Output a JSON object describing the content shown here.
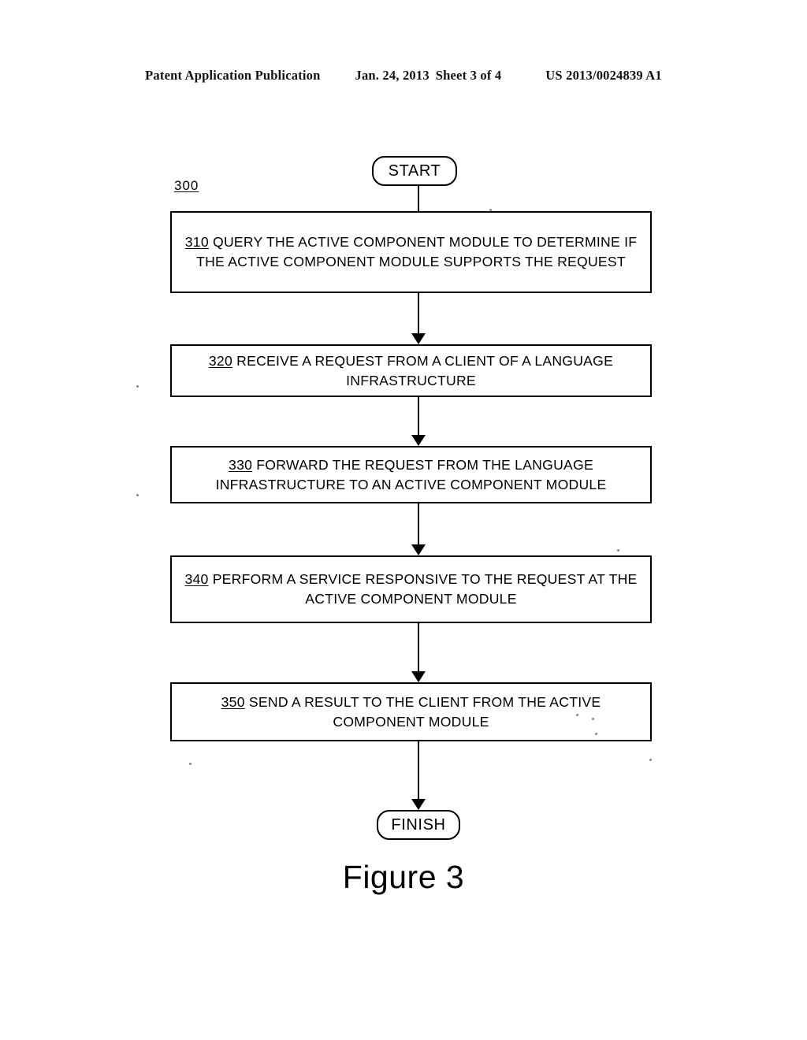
{
  "header": {
    "publication": "Patent Application Publication",
    "date": "Jan. 24, 2013",
    "sheet": "Sheet 3 of 4",
    "patent_number": "US 2013/0024839 A1"
  },
  "figure": {
    "caption": "Figure 3",
    "diagram_ref": "300",
    "type": "flowchart",
    "start_label": "START",
    "finish_label": "FINISH"
  },
  "steps": [
    {
      "ref": "310",
      "text": " QUERY THE ACTIVE COMPONENT MODULE TO DETERMINE IF THE ACTIVE COMPONENT MODULE SUPPORTS THE REQUEST"
    },
    {
      "ref": "320",
      "text": " RECEIVE A REQUEST FROM A CLIENT OF A LANGUAGE INFRASTRUCTURE"
    },
    {
      "ref": "330",
      "text": " FORWARD THE REQUEST FROM THE LANGUAGE INFRASTRUCTURE TO AN ACTIVE COMPONENT MODULE"
    },
    {
      "ref": "340",
      "text": " PERFORM A SERVICE RESPONSIVE TO THE REQUEST AT THE ACTIVE COMPONENT MODULE"
    },
    {
      "ref": "350",
      "text": " SEND A RESULT TO THE CLIENT FROM THE ACTIVE COMPONENT MODULE"
    }
  ],
  "colors": {
    "ink": "#000000",
    "page": "#ffffff"
  }
}
